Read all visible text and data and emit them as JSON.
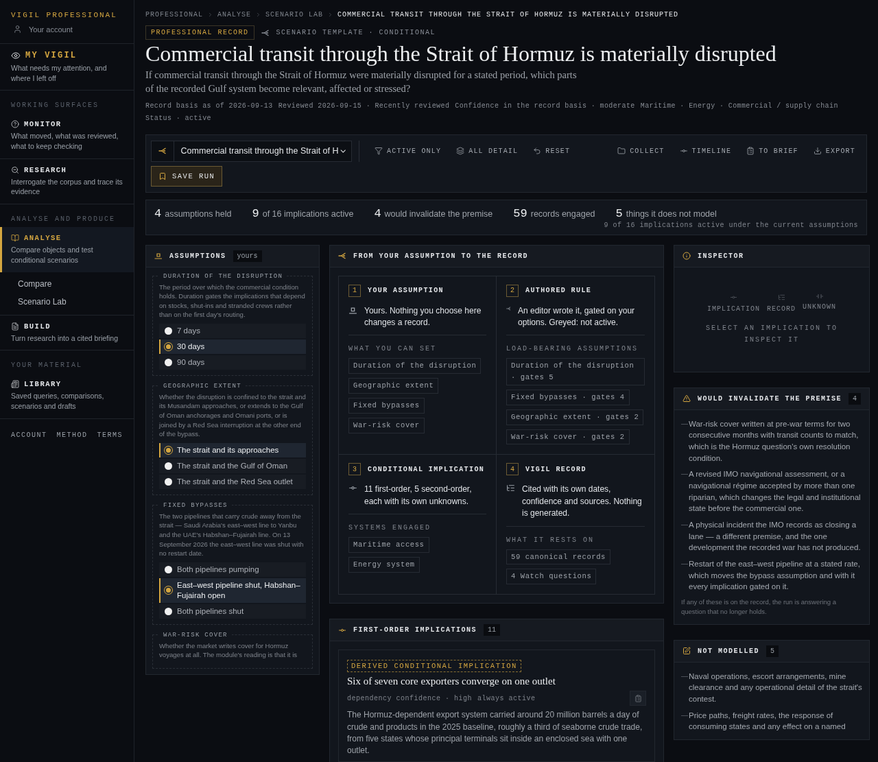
{
  "sidebar": {
    "brand": "VIGIL PROFESSIONAL",
    "account": "Your account",
    "items": [
      {
        "kind": "primary",
        "title": "MY VIGIL",
        "description": "What needs my attention, and where I left off",
        "selected": false
      },
      {
        "kind": "heading",
        "label": "WORKING SURFACES"
      },
      {
        "kind": "nav",
        "title": "MONITOR",
        "description": "What moved, what was reviewed, what to keep checking",
        "selected": false
      },
      {
        "kind": "nav",
        "title": "RESEARCH",
        "description": "Interrogate the corpus and trace its evidence",
        "selected": false
      },
      {
        "kind": "heading",
        "label": "ANALYSE AND PRODUCE"
      },
      {
        "kind": "nav",
        "title": "ANALYSE",
        "description": "Compare objects and test conditional scenarios",
        "selected": true,
        "children": [
          "Compare",
          "Scenario Lab"
        ]
      },
      {
        "kind": "nav",
        "title": "BUILD",
        "description": "Turn research into a cited briefing",
        "selected": false
      },
      {
        "kind": "heading",
        "label": "YOUR MATERIAL"
      },
      {
        "kind": "nav",
        "title": "LIBRARY",
        "description": "Saved queries, comparisons, scenarios and drafts",
        "selected": false
      }
    ],
    "footer_links": [
      "ACCOUNT",
      "METHOD",
      "TERMS"
    ]
  },
  "breadcrumb": [
    {
      "label": "PROFESSIONAL",
      "current": false
    },
    {
      "label": "ANALYSE",
      "current": false
    },
    {
      "label": "SCENARIO LAB",
      "current": false
    },
    {
      "label": "COMMERCIAL TRANSIT THROUGH THE STRAIT OF HORMUZ IS MATERIALLY DISRUPTED",
      "current": true
    }
  ],
  "header": {
    "badge": "PROFESSIONAL RECORD",
    "template": "SCENARIO TEMPLATE · CONDITIONAL",
    "title": "Commercial transit through the Strait of Hormuz is materially disrupted",
    "question": "If commercial transit through the Strait of Hormuz were materially disrupted for a stated period, which parts of the recorded Gulf system become relevant, affected or stressed?",
    "meta": [
      "Record basis as of 2026-09-13",
      "Reviewed 2026-09-15 · Recently reviewed",
      "Confidence in the record basis · moderate",
      "Maritime · Energy · Commercial / supply chain",
      "Status · active"
    ]
  },
  "toolbar": {
    "scenario": "Commercial transit through the Strait of H",
    "actions": [
      "ACTIVE ONLY",
      "ALL DETAIL",
      "RESET"
    ],
    "exports": [
      "COLLECT",
      "TIMELINE",
      "TO BRIEF",
      "EXPORT"
    ],
    "save": "SAVE RUN"
  },
  "stats": {
    "items": [
      {
        "value": "4",
        "label": "assumptions held"
      },
      {
        "value": "9",
        "label": "of 16 implications active"
      },
      {
        "value": "4",
        "label": "would invalidate the premise"
      },
      {
        "value": "59",
        "label": "records engaged"
      },
      {
        "value": "5",
        "label": "things it does not model"
      }
    ],
    "note": "9 of 16 implications active under the current assumptions"
  },
  "assumptions": {
    "title": "ASSUMPTIONS",
    "tag": "yours",
    "groups": [
      {
        "title": "DURATION OF THE DISRUPTION",
        "description": "The period over which the commercial condition holds. Duration gates the implications that depend on stocks, shut-ins and stranded crews rather than on the first day's routing.",
        "options": [
          {
            "label": "7 days",
            "selected": false
          },
          {
            "label": "30 days",
            "selected": true
          },
          {
            "label": "90 days",
            "selected": false
          }
        ]
      },
      {
        "title": "GEOGRAPHIC EXTENT",
        "description": "Whether the disruption is confined to the strait and its Musandam approaches, or extends to the Gulf of Oman anchorages and Omani ports, or is joined by a Red Sea interruption at the other end of the bypass.",
        "options": [
          {
            "label": "The strait and its approaches",
            "selected": true
          },
          {
            "label": "The strait and the Gulf of Oman",
            "selected": false
          },
          {
            "label": "The strait and the Red Sea outlet",
            "selected": false
          }
        ]
      },
      {
        "title": "FIXED BYPASSES",
        "description": "The two pipelines that carry crude away from the strait — Saudi Arabia's east–west line to Yanbu and the UAE's Habshan–Fujairah line. On 13 September 2026 the east–west line was shut with no restart date.",
        "options": [
          {
            "label": "Both pipelines pumping",
            "selected": false
          },
          {
            "label": "East–west pipeline shut, Habshan–Fujairah open",
            "selected": true
          },
          {
            "label": "Both pipelines shut",
            "selected": false
          }
        ]
      },
      {
        "title": "WAR-RISK COVER",
        "description": "Whether the market writes cover for Hormuz voyages at all. The module's reading is that it is"
      }
    ]
  },
  "flow": {
    "title": "FROM YOUR ASSUMPTION TO THE RECORD",
    "steps": [
      {
        "number": "1",
        "title": "YOUR ASSUMPTION",
        "text": "Yours. Nothing you choose here changes a record.",
        "list_heading": "WHAT YOU CAN SET",
        "chips": [
          "Duration of the disruption",
          "Geographic extent",
          "Fixed bypasses",
          "War-risk cover"
        ]
      },
      {
        "number": "2",
        "title": "AUTHORED RULE",
        "text": "An editor wrote it, gated on your options. Greyed: not active.",
        "list_heading": "LOAD-BEARING ASSUMPTIONS",
        "chips": [
          "Duration of the disruption · gates 5",
          "Fixed bypasses · gates 4",
          "Geographic extent · gates 2",
          "War-risk cover · gates 2"
        ]
      },
      {
        "number": "3",
        "title": "CONDITIONAL IMPLICATION",
        "text": "11 first-order, 5 second-order, each with its own unknowns.",
        "list_heading": "SYSTEMS ENGAGED",
        "chips": [
          "Maritime access",
          "Energy system"
        ]
      },
      {
        "number": "4",
        "title": "VIGIL RECORD",
        "text": "Cited with its own dates, confidence and sources. Nothing is generated.",
        "list_heading": "WHAT IT RESTS ON",
        "chips": [
          "59 canonical records",
          "4 Watch questions"
        ]
      }
    ]
  },
  "implications": {
    "title": "FIRST-ORDER IMPLICATIONS",
    "count": "11",
    "card": {
      "badge": "DERIVED CONDITIONAL IMPLICATION",
      "title": "Six of seven core exporters converge on one outlet",
      "meta": [
        "dependency confidence · high",
        "always active"
      ],
      "body": "The Hormuz-dependent export system carried around 20 million barrels a day of crude and products in the 2025 baseline, roughly a third of seaborne crude trade, from five states whose principal terminals sit inside an enclosed sea with one outlet."
    }
  },
  "inspector": {
    "title": "INSPECTOR",
    "legend": [
      "IMPLICATION",
      "RECORD",
      "UNKNOWN"
    ],
    "message": "SELECT AN IMPLICATION TO INSPECT IT"
  },
  "invalidators": {
    "title": "WOULD INVALIDATE THE PREMISE",
    "count": "4",
    "items": [
      "War-risk cover written at pre-war terms for two consecutive months with transit counts to match, which is the Hormuz question's own resolution condition.",
      "A revised IMO navigational assessment, or a navigational régime accepted by more than one riparian, which changes the legal and institutional state before the commercial one.",
      "A physical incident the IMO records as closing a lane — a different premise, and the one development the recorded war has not produced.",
      "Restart of the east–west pipeline at a stated rate, which moves the bypass assumption and with it every implication gated on it."
    ],
    "footnote": "If any of these is on the record, the run is answering a question that no longer holds."
  },
  "not_modelled": {
    "title": "NOT MODELLED",
    "count": "5",
    "items": [
      "Naval operations, escort arrangements, mine clearance and any operational detail of the strait's contest.",
      "Price paths, freight rates, the response of consuming states and any effect on a named"
    ]
  }
}
